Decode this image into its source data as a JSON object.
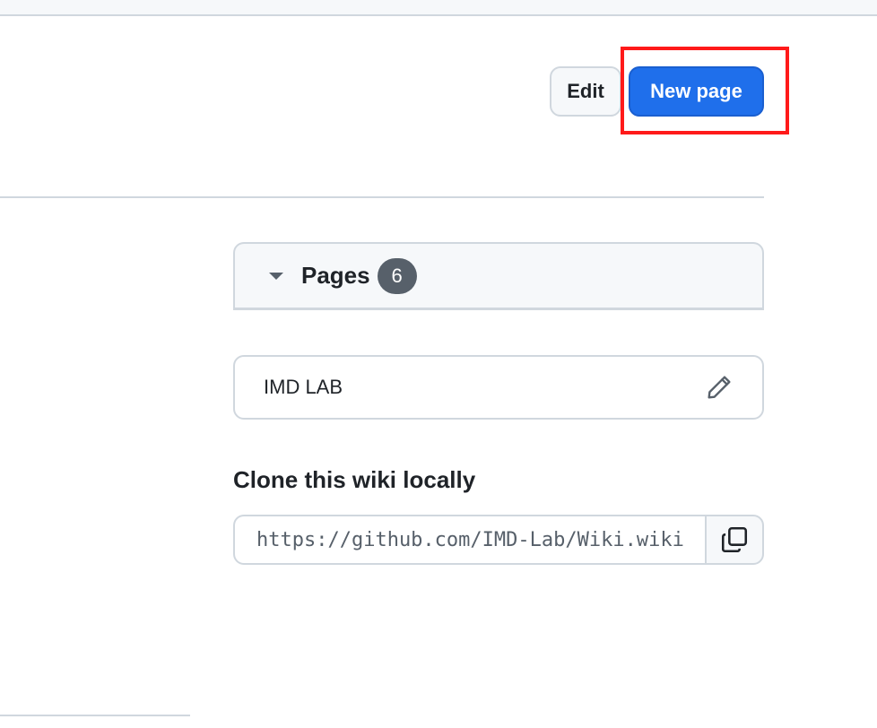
{
  "header": {
    "edit_label": "Edit",
    "new_page_label": "New page"
  },
  "sidebar": {
    "pages_label": "Pages",
    "pages_count": "6",
    "wiki_title": "IMD LAB"
  },
  "clone": {
    "heading": "Clone this wiki locally",
    "url": "https://github.com/IMD-Lab/Wiki.wiki.git"
  },
  "icons": {
    "caret": "triangle-down-icon",
    "edit": "pencil-icon",
    "copy": "copy-icon"
  },
  "colors": {
    "primary": "#1f6feb",
    "highlight": "#ff1a1a",
    "border": "#d0d7de",
    "badge": "#57606a"
  }
}
